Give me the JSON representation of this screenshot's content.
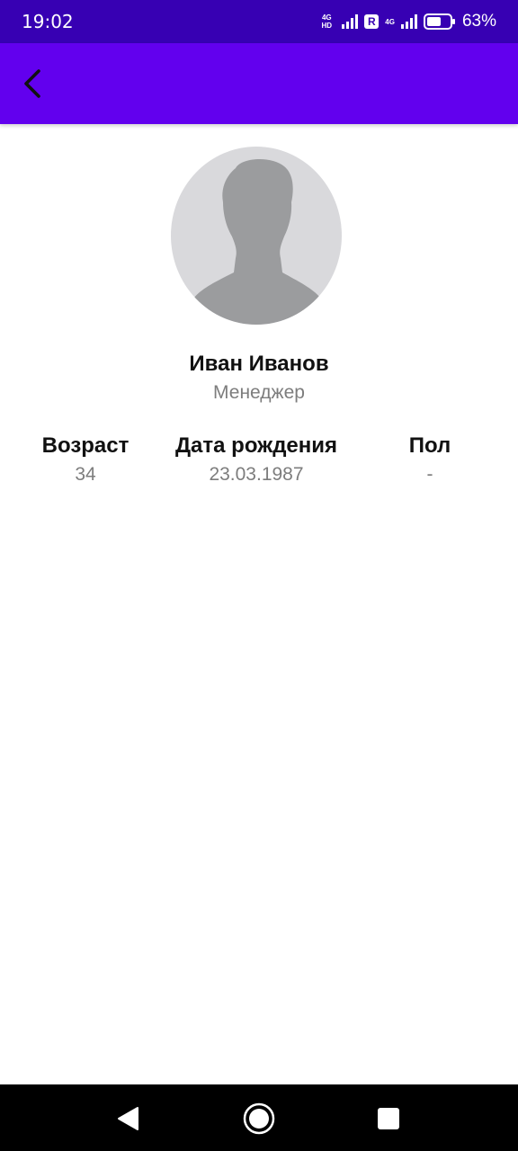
{
  "status_bar": {
    "time": "19:02",
    "network_tag_1": "4G HD",
    "roaming": "R",
    "network_tag_2": "4G",
    "battery_percent_label": "63%",
    "battery_level": 0.63
  },
  "app_bar": {
    "background_color": "#6200ee",
    "back_icon": "chevron-left-icon"
  },
  "profile": {
    "avatar_icon": "person-placeholder-icon",
    "name": "Иван Иванов",
    "role": "Менеджер"
  },
  "info": [
    {
      "label": "Возраст",
      "value": "34"
    },
    {
      "label": "Дата рождения",
      "value": "23.03.1987"
    },
    {
      "label": "Пол",
      "value": "-"
    }
  ],
  "nav_bar": {
    "back_icon": "triangle-back-icon",
    "home_icon": "circle-home-icon",
    "recents_icon": "square-recents-icon"
  }
}
